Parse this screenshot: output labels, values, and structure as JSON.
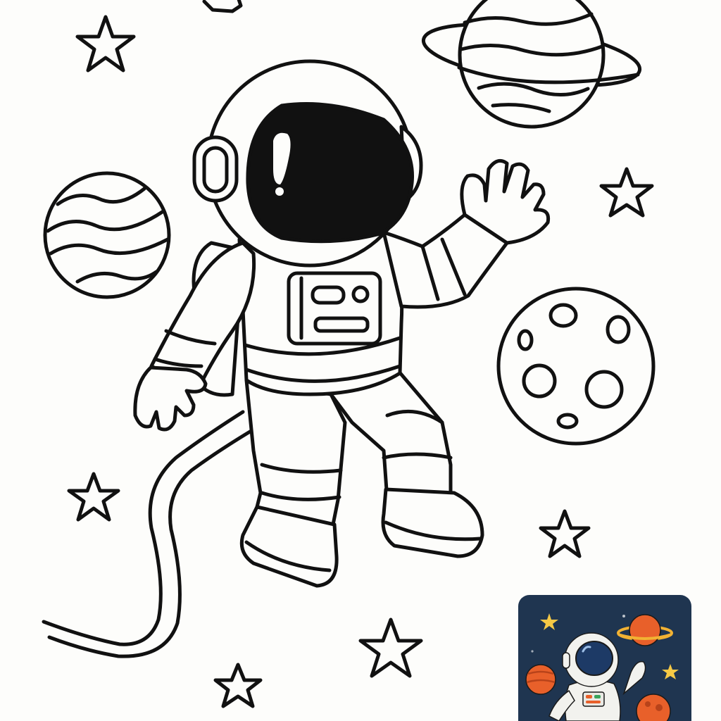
{
  "page": {
    "background": "#fdfdfb",
    "line_color": "#111111"
  },
  "coloring_page": {
    "subject": "astronaut",
    "elements": [
      "astronaut",
      "ringed-planet",
      "striped-planet",
      "moon",
      "tether",
      "stars"
    ]
  },
  "preview_thumbnail": {
    "background": "#1f3550",
    "colors": {
      "planet": "#e8602a",
      "planet_ring": "#f2b233",
      "star": "#f6c945",
      "suit": "#f2f2ee",
      "visor": "#1d3a66"
    }
  }
}
